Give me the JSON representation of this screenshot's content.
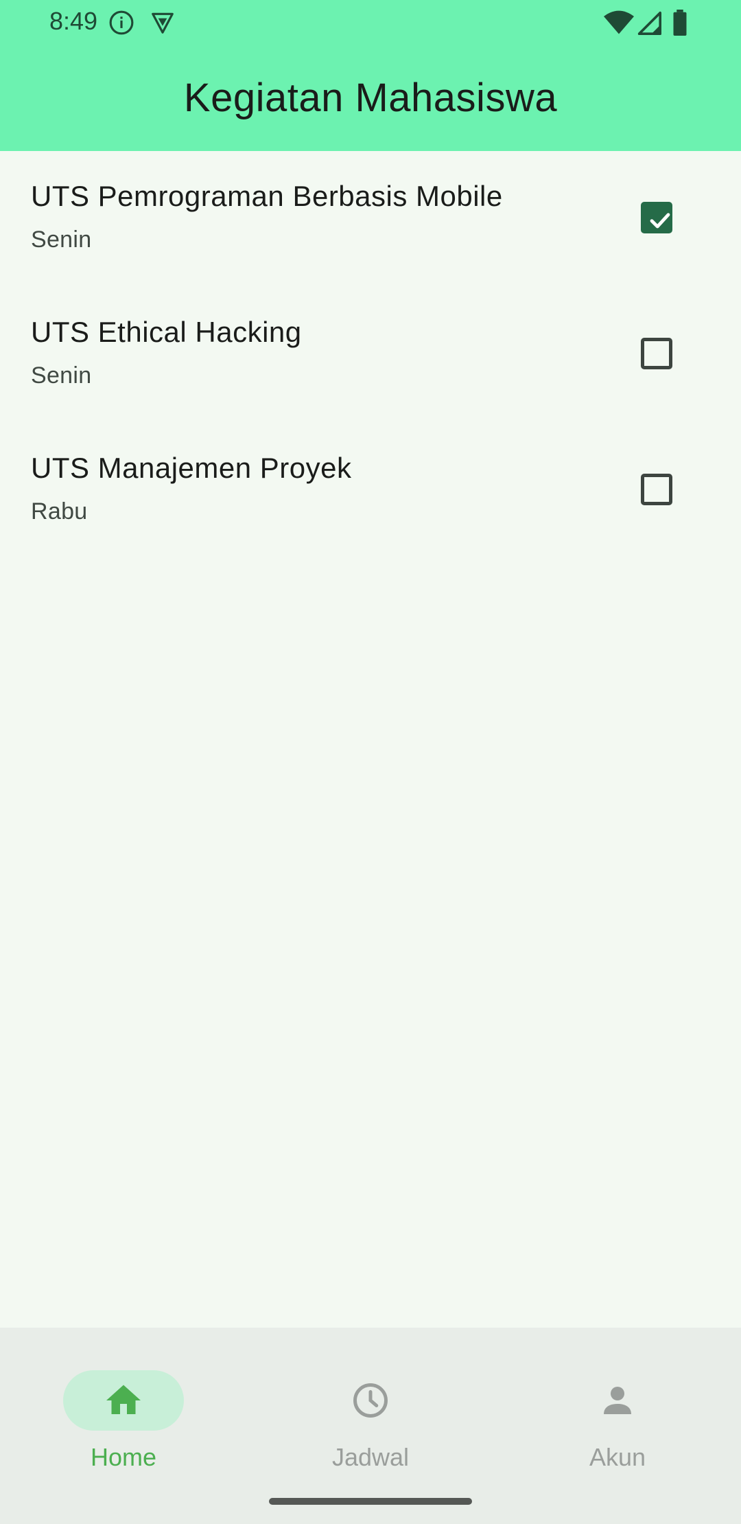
{
  "status_bar": {
    "time": "8:49",
    "icons": [
      "info-icon",
      "vpn-shield-icon",
      "wifi-icon",
      "cell-signal-icon",
      "battery-icon"
    ]
  },
  "app_bar": {
    "title": "Kegiatan Mahasiswa",
    "background_color": "#6cf2b0"
  },
  "activities": [
    {
      "title": "UTS Pemrograman Berbasis Mobile",
      "day": "Senin",
      "checked": true
    },
    {
      "title": "UTS Ethical Hacking",
      "day": "Senin",
      "checked": false
    },
    {
      "title": "UTS Manajemen Proyek",
      "day": "Rabu",
      "checked": false
    }
  ],
  "bottom_nav": {
    "items": [
      {
        "label": "Home",
        "icon": "home-icon",
        "active": true
      },
      {
        "label": "Jadwal",
        "icon": "clock-icon",
        "active": false
      },
      {
        "label": "Akun",
        "icon": "person-icon",
        "active": false
      }
    ],
    "active_color": "#4caf50",
    "inactive_color": "#9a9e9b"
  }
}
